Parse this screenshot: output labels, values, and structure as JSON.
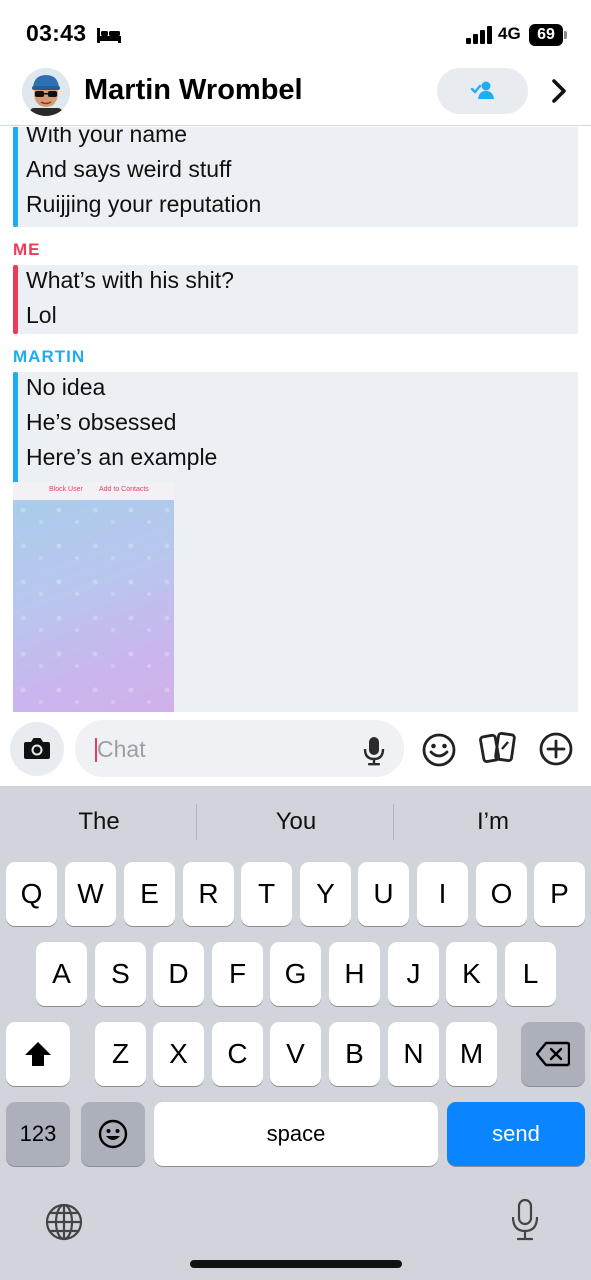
{
  "status": {
    "time": "03:43",
    "network": "4G",
    "battery": "69"
  },
  "header": {
    "contact_name": "Martin Wrombel"
  },
  "messages": [
    {
      "sender": "",
      "lines": [
        "With your name",
        "And says weird stuff",
        "Ruijjing your reputation"
      ]
    },
    {
      "sender": "ME",
      "lines": [
        "What’s with his shit?",
        "Lol"
      ]
    },
    {
      "sender": "MARTIN",
      "lines": [
        "No idea",
        "He’s obsessed",
        "Here’s an example"
      ]
    }
  ],
  "snap_image": {
    "block_label": "Block User",
    "add_label": "Add to Contacts"
  },
  "input": {
    "placeholder": "Chat"
  },
  "keyboard": {
    "suggestions": [
      "The",
      "You",
      "I’m"
    ],
    "row1": [
      "Q",
      "W",
      "E",
      "R",
      "T",
      "Y",
      "U",
      "I",
      "O",
      "P"
    ],
    "row2": [
      "A",
      "S",
      "D",
      "F",
      "G",
      "H",
      "J",
      "K",
      "L"
    ],
    "row3": [
      "Z",
      "X",
      "C",
      "V",
      "B",
      "N",
      "M"
    ],
    "numbers_label": "123",
    "space_label": "space",
    "send_label": "send"
  },
  "colors": {
    "martin": "#1fadf2",
    "me": "#ee3b5b",
    "send": "#0a84ff"
  }
}
